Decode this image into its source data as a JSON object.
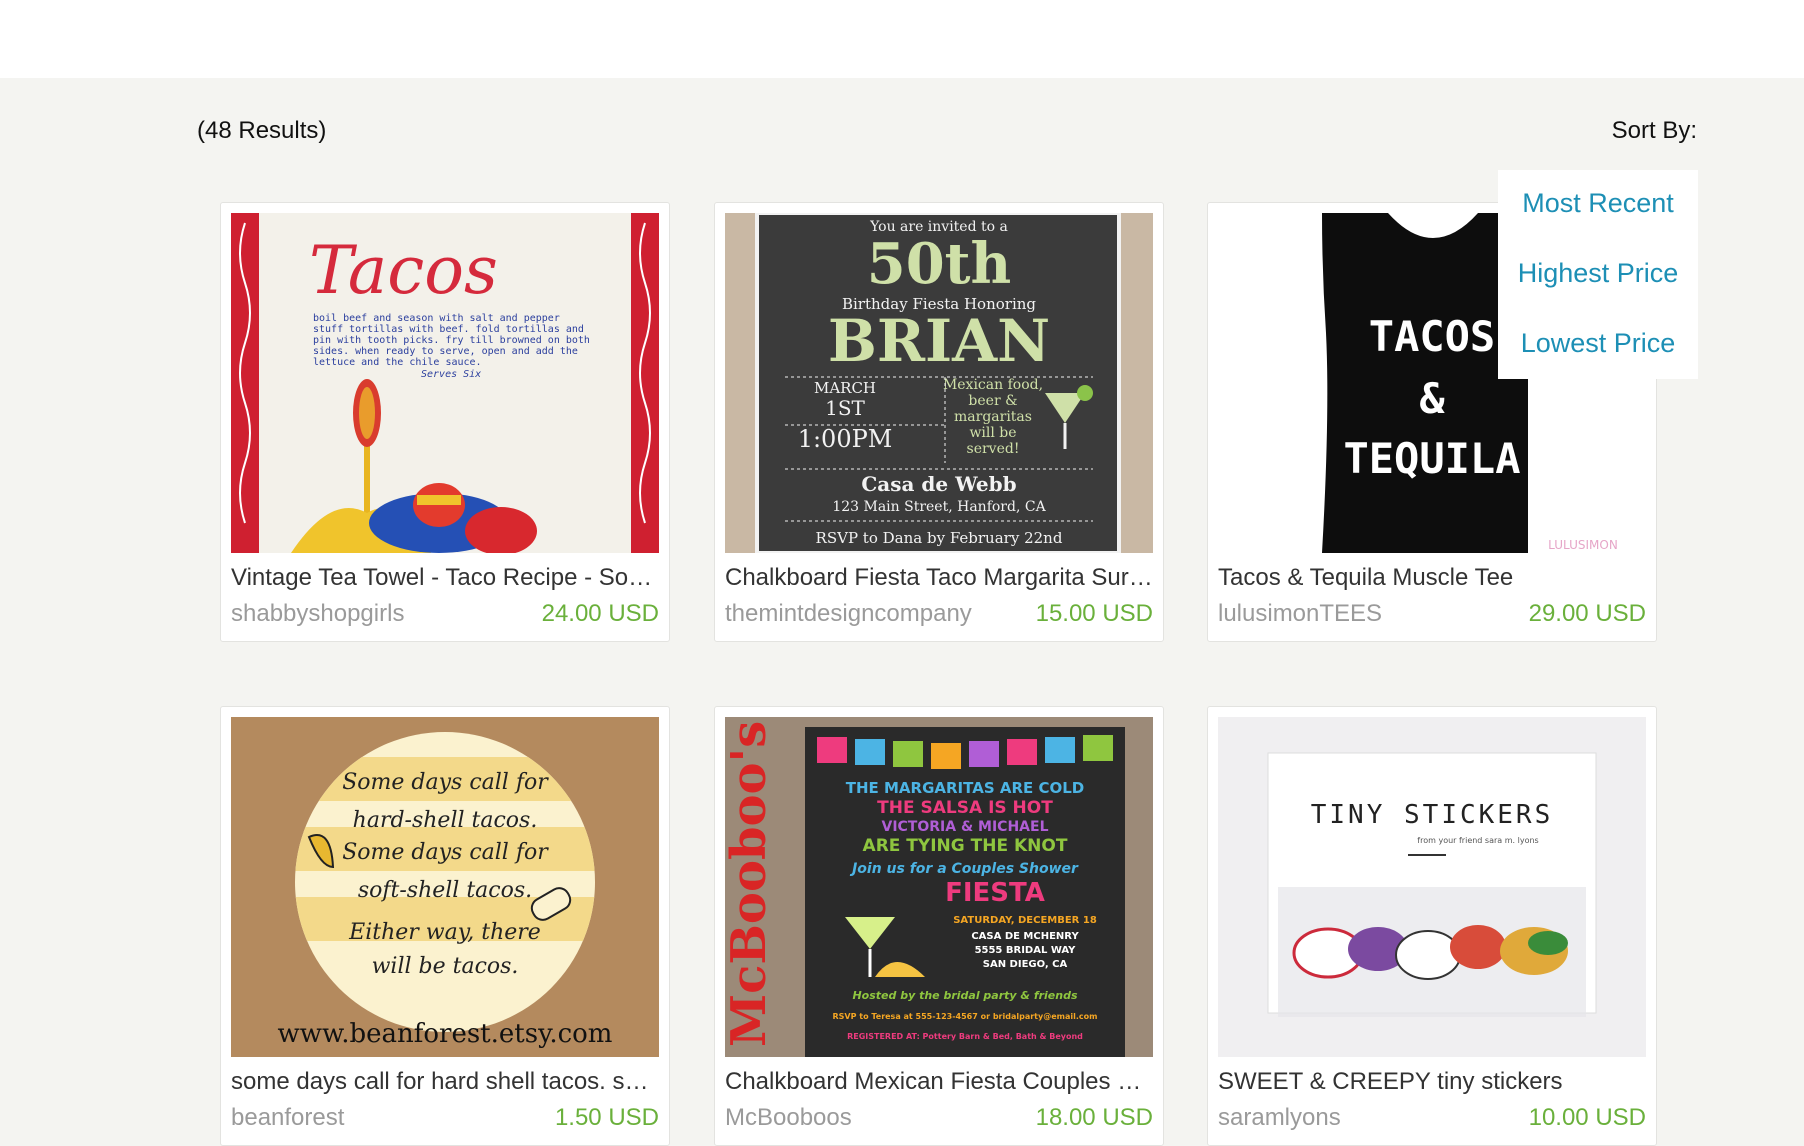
{
  "results_count": "(48 Results)",
  "sort": {
    "label": "Sort By:",
    "options": [
      "Most Recent",
      "Highest Price",
      "Lowest Price"
    ]
  },
  "colors": {
    "link": "#1d8fb5",
    "price": "#6ab03b",
    "shop": "#9a9a9a",
    "background": "#f4f4f1"
  },
  "listings": [
    {
      "title": "Vintage Tea Towel - Taco Recipe - Sombrero",
      "shop": "shabbyshopgirls",
      "price": "24.00 USD",
      "image_text": {
        "heading": "Tacos",
        "line1": "boil beef and season with salt and pepper",
        "line2": "stuff tortillas with beef. fold tortillas and",
        "line3": "pin with tooth picks. fry till browned on both",
        "line4": "sides. when ready to serve, open and add the",
        "line5": "lettuce and the chile sauce.",
        "line6": "Serves Six"
      }
    },
    {
      "title": "Chalkboard Fiesta Taco Margarita Surprise Party Invitation",
      "shop": "themintdesigncompany",
      "price": "15.00 USD",
      "image_text": {
        "invited": "You are invited to a",
        "age": "50th",
        "honoring": "Birthday Fiesta Honoring",
        "name": "BRIAN",
        "month": "MARCH",
        "day": "1ST",
        "time": "1:00PM",
        "food1": "Mexican food,",
        "food2": "beer &",
        "food3": "margaritas",
        "food4": "will be",
        "food5": "served!",
        "venue": "Casa de Webb",
        "address": "123 Main Street, Hanford, CA",
        "rsvp": "RSVP to Dana by February 22nd"
      }
    },
    {
      "title": "Tacos & Tequila Muscle Tee",
      "shop": "lulusimonTEES",
      "price": "29.00 USD",
      "image_text": {
        "line1": "TACOS",
        "line2": "&",
        "line3": "TEQUILA",
        "brand": "LULUSIMON"
      }
    },
    {
      "title": "some days call for hard shell tacos. some days call for soft shell tacos",
      "shop": "beanforest",
      "price": "1.50 USD",
      "image_text": {
        "line1": "Some days call for",
        "line2": "hard-shell tacos.",
        "line3": "Some days call for",
        "line4": "soft-shell tacos.",
        "line5": "Either way, there",
        "line6": "will be tacos.",
        "url": "www.beanforest.etsy.com"
      }
    },
    {
      "title": "Chalkboard Mexican Fiesta Couples Shower Invitation",
      "shop": "McBooboos",
      "price": "18.00 USD",
      "image_text": {
        "brand": "McBooboo's",
        "line1": "THE MARGARITAS ARE COLD",
        "line2": "THE SALSA IS HOT",
        "line3": "VICTORIA & MICHAEL",
        "line4": "ARE TYING THE KNOT",
        "line5": "Join us for a Couples Shower",
        "line6": "FIESTA",
        "line7": "SATURDAY, DECEMBER 18",
        "line8": "CASA DE MCHENRY",
        "line9": "5555 BRIDAL WAY",
        "line10": "SAN DIEGO, CA",
        "line11": "Hosted by the bridal party & friends",
        "line12": "RSVP to Teresa at 555-123-4567 or bridalparty@email.com",
        "line13": "REGISTERED AT: Pottery Barn & Bed, Bath & Beyond"
      }
    },
    {
      "title": "SWEET & CREEPY tiny stickers",
      "shop": "saramlyons",
      "price": "10.00 USD",
      "image_text": {
        "heading": "TINY STICKERS",
        "sub": "from your friend sara m. lyons"
      }
    }
  ]
}
